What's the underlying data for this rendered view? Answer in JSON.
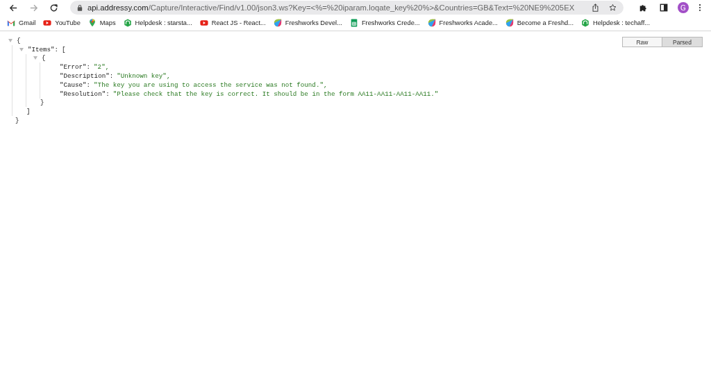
{
  "browser": {
    "url_host": "api.addressy.com",
    "url_path": "/Capture/Interactive/Find/v1.00/json3.ws?Key=<%=%20iparam.loqate_key%20%>&Countries=GB&Text=%20NE9%205EX",
    "back_disabled": false,
    "forward_disabled": true,
    "profile_initial": "G"
  },
  "bookmarks": [
    {
      "label": "Gmail",
      "kind": "gmail"
    },
    {
      "label": "YouTube",
      "kind": "youtube"
    },
    {
      "label": "Maps",
      "kind": "maps"
    },
    {
      "label": "Helpdesk : starsta...",
      "kind": "helpdesk"
    },
    {
      "label": "React JS - React...",
      "kind": "youtube"
    },
    {
      "label": "Freshworks Devel...",
      "kind": "freshworks"
    },
    {
      "label": "Freshworks Crede...",
      "kind": "sheets"
    },
    {
      "label": "Freshworks Acade...",
      "kind": "freshworks"
    },
    {
      "label": "Become a Freshd...",
      "kind": "freshworks"
    },
    {
      "label": "Helpdesk : techaff...",
      "kind": "helpdesk"
    }
  ],
  "view_toggle": [
    {
      "label": "Raw",
      "selected": false
    },
    {
      "label": "Parsed",
      "selected": true
    }
  ],
  "json_tree": {
    "open": "{",
    "close": "}",
    "expanded": true,
    "children": [
      {
        "key": "\"Items\":",
        "open": "[",
        "close": "]",
        "expanded": true,
        "children": [
          {
            "open": "{",
            "close": "}",
            "expanded": true,
            "children": [
              {
                "key": "\"Error\":",
                "value": "\"2\","
              },
              {
                "key": "\"Description\":",
                "value": "\"Unknown key\","
              },
              {
                "key": "\"Cause\":",
                "value": "\"The key you are using to access the service was not found.\","
              },
              {
                "key": "\"Resolution\":",
                "value": "\"Please check that the key is correct. It should be in the form AA11-AA11-AA11-AA11.\""
              }
            ]
          }
        ]
      }
    ]
  }
}
